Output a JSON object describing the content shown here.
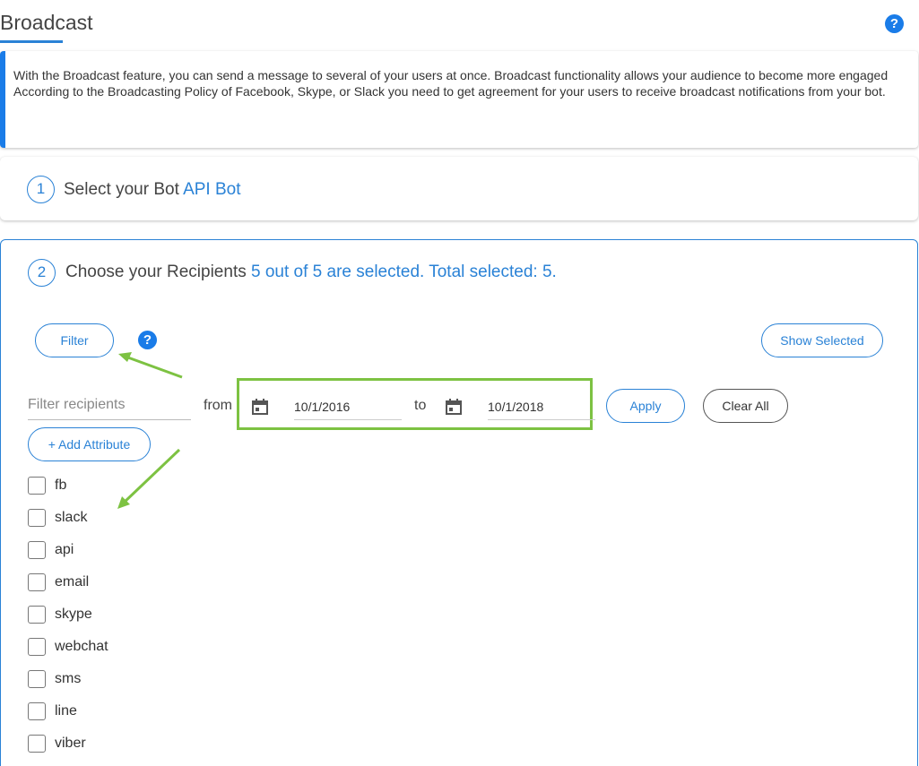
{
  "header": {
    "title": "Broadcast",
    "help_label": "?"
  },
  "info": {
    "line1": "With the Broadcast feature, you can send a message to several of your users at once. Broadcast functionality allows your audience to become more engaged",
    "line2": "According to the Broadcasting Policy of Facebook, Skype, or Slack you need to get agreement for your users to receive broadcast notifications from your bot."
  },
  "step1": {
    "number": "1",
    "label": "Select your Bot",
    "value": "API Bot"
  },
  "step2": {
    "number": "2",
    "label": "Choose your Recipients",
    "value": "5 out of 5 are selected. Total selected: 5."
  },
  "filter": {
    "button_label": "Filter",
    "help_label": "?",
    "show_selected_label": "Show Selected",
    "input_placeholder": "Filter recipients",
    "from_label": "from",
    "from_date": "10/1/2016",
    "to_label": "to",
    "to_date": "10/1/2018",
    "apply_label": "Apply",
    "clear_all_label": "Clear All",
    "add_attribute_label": "+ Add Attribute"
  },
  "channels": [
    {
      "label": "fb",
      "checked": false
    },
    {
      "label": "slack",
      "checked": false
    },
    {
      "label": "api",
      "checked": false
    },
    {
      "label": "email",
      "checked": false
    },
    {
      "label": "skype",
      "checked": false
    },
    {
      "label": "webchat",
      "checked": false
    },
    {
      "label": "sms",
      "checked": false
    },
    {
      "label": "line",
      "checked": false
    },
    {
      "label": "viber",
      "checked": false
    }
  ],
  "colors": {
    "accent": "#2a82d6",
    "help": "#1a7ce8",
    "highlight": "#7dc242"
  },
  "icons": [
    "help-icon",
    "calendar-icon",
    "arrow-annotation"
  ]
}
